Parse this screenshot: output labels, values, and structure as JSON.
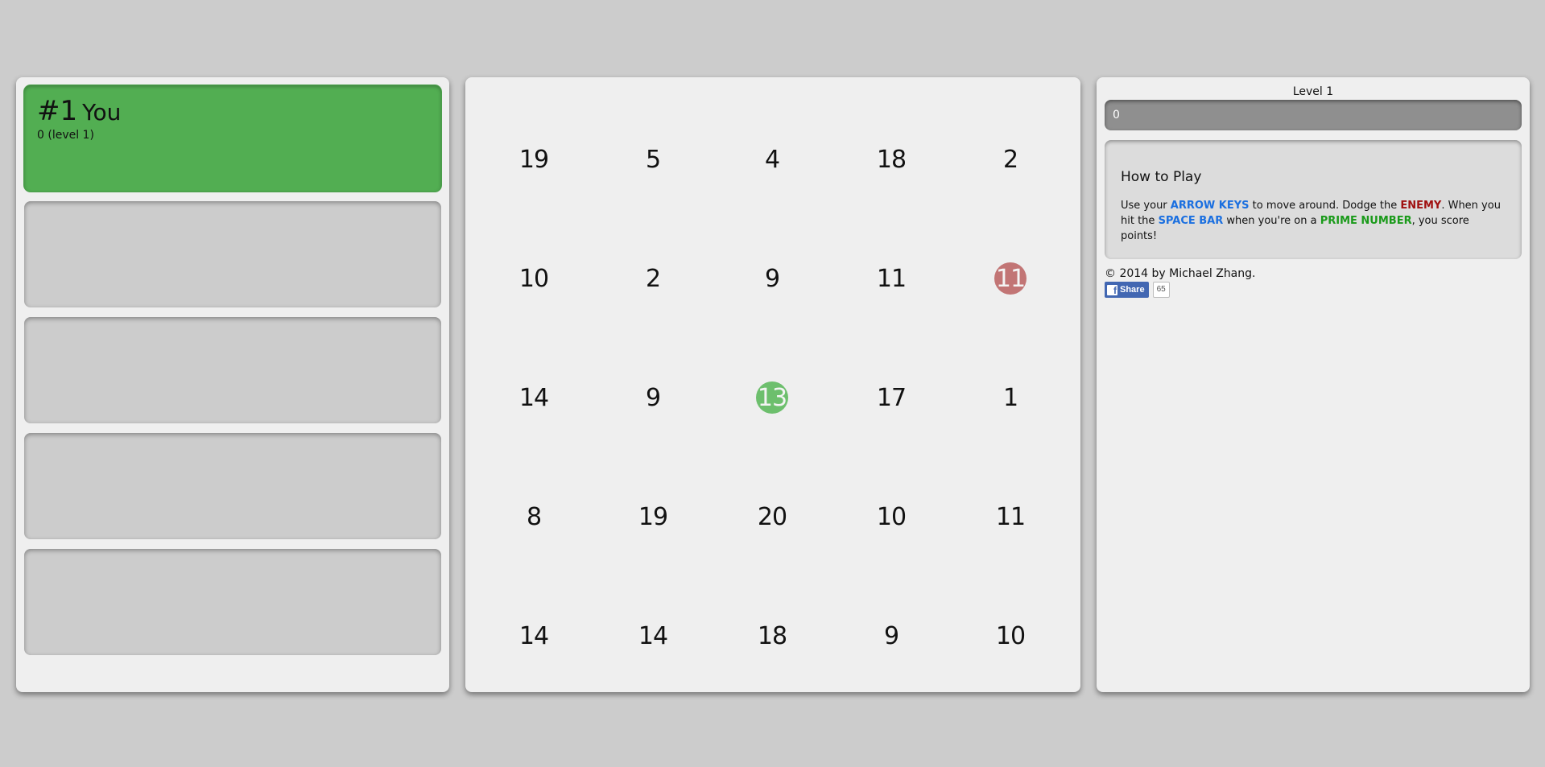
{
  "leaderboard": {
    "entries": [
      {
        "rank": "#1",
        "name": "You",
        "detail": "0 (level 1)"
      }
    ],
    "empty_slots": 4
  },
  "board": {
    "rows": [
      [
        "19",
        "5",
        "4",
        "18",
        "2"
      ],
      [
        "10",
        "2",
        "9",
        "11",
        "11"
      ],
      [
        "14",
        "9",
        "13",
        "17",
        "1"
      ],
      [
        "8",
        "19",
        "20",
        "10",
        "11"
      ],
      [
        "14",
        "14",
        "18",
        "9",
        "10"
      ]
    ],
    "enemy": {
      "row": 1,
      "col": 4
    },
    "player": {
      "row": 2,
      "col": 2
    },
    "colors": {
      "enemy": "#c27575",
      "player": "#6dbf6d"
    }
  },
  "info": {
    "level_label": "Level 1",
    "score": "0",
    "howto": {
      "title": "How to Play",
      "t1": "Use your ",
      "k1": "ARROW KEYS",
      "t2": " to move around. Dodge the ",
      "k2": "ENEMY",
      "t3": ". When you hit the ",
      "k3": "SPACE BAR",
      "t4": " when you're on a ",
      "k4": "PRIME NUMBER",
      "t5": ", you score points!"
    },
    "copyright": "© 2014 by Michael Zhang.",
    "share": {
      "label": "Share",
      "icon": "facebook-icon",
      "count": "65"
    }
  }
}
